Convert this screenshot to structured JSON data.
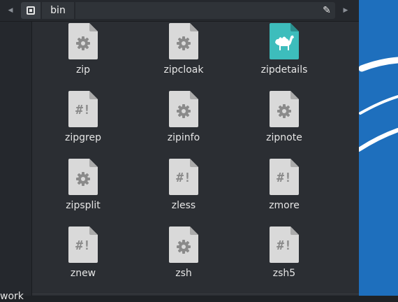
{
  "pathbar": {
    "back_icon": "chevron-left-icon",
    "forward_icon": "chevron-right-icon",
    "root_icon": "drive-icon",
    "current_folder": "bin",
    "edit_icon": "pencil-icon"
  },
  "sidebar": {
    "visible_label": "work"
  },
  "files": [
    {
      "name": "zip",
      "icon": "gear-icon"
    },
    {
      "name": "zipcloak",
      "icon": "gear-icon"
    },
    {
      "name": "zipdetails",
      "icon": "camel-icon"
    },
    {
      "name": "zipgrep",
      "icon": "hashbang-icon"
    },
    {
      "name": "zipinfo",
      "icon": "gear-icon"
    },
    {
      "name": "zipnote",
      "icon": "gear-icon"
    },
    {
      "name": "zipsplit",
      "icon": "gear-icon"
    },
    {
      "name": "zless",
      "icon": "hashbang-icon"
    },
    {
      "name": "zmore",
      "icon": "hashbang-icon"
    },
    {
      "name": "znew",
      "icon": "hashbang-icon"
    },
    {
      "name": "zsh",
      "icon": "gear-icon"
    },
    {
      "name": "zsh5",
      "icon": "hashbang-icon"
    }
  ],
  "colors": {
    "doc_fill": "#d9d9d9",
    "doc_fold": "#ababab",
    "doc_glyph": "#8a8a8a",
    "perl_fill": "#3dbdbc",
    "perl_fold": "#2a8f8e",
    "desktop_blue": "#1e6fbd"
  }
}
